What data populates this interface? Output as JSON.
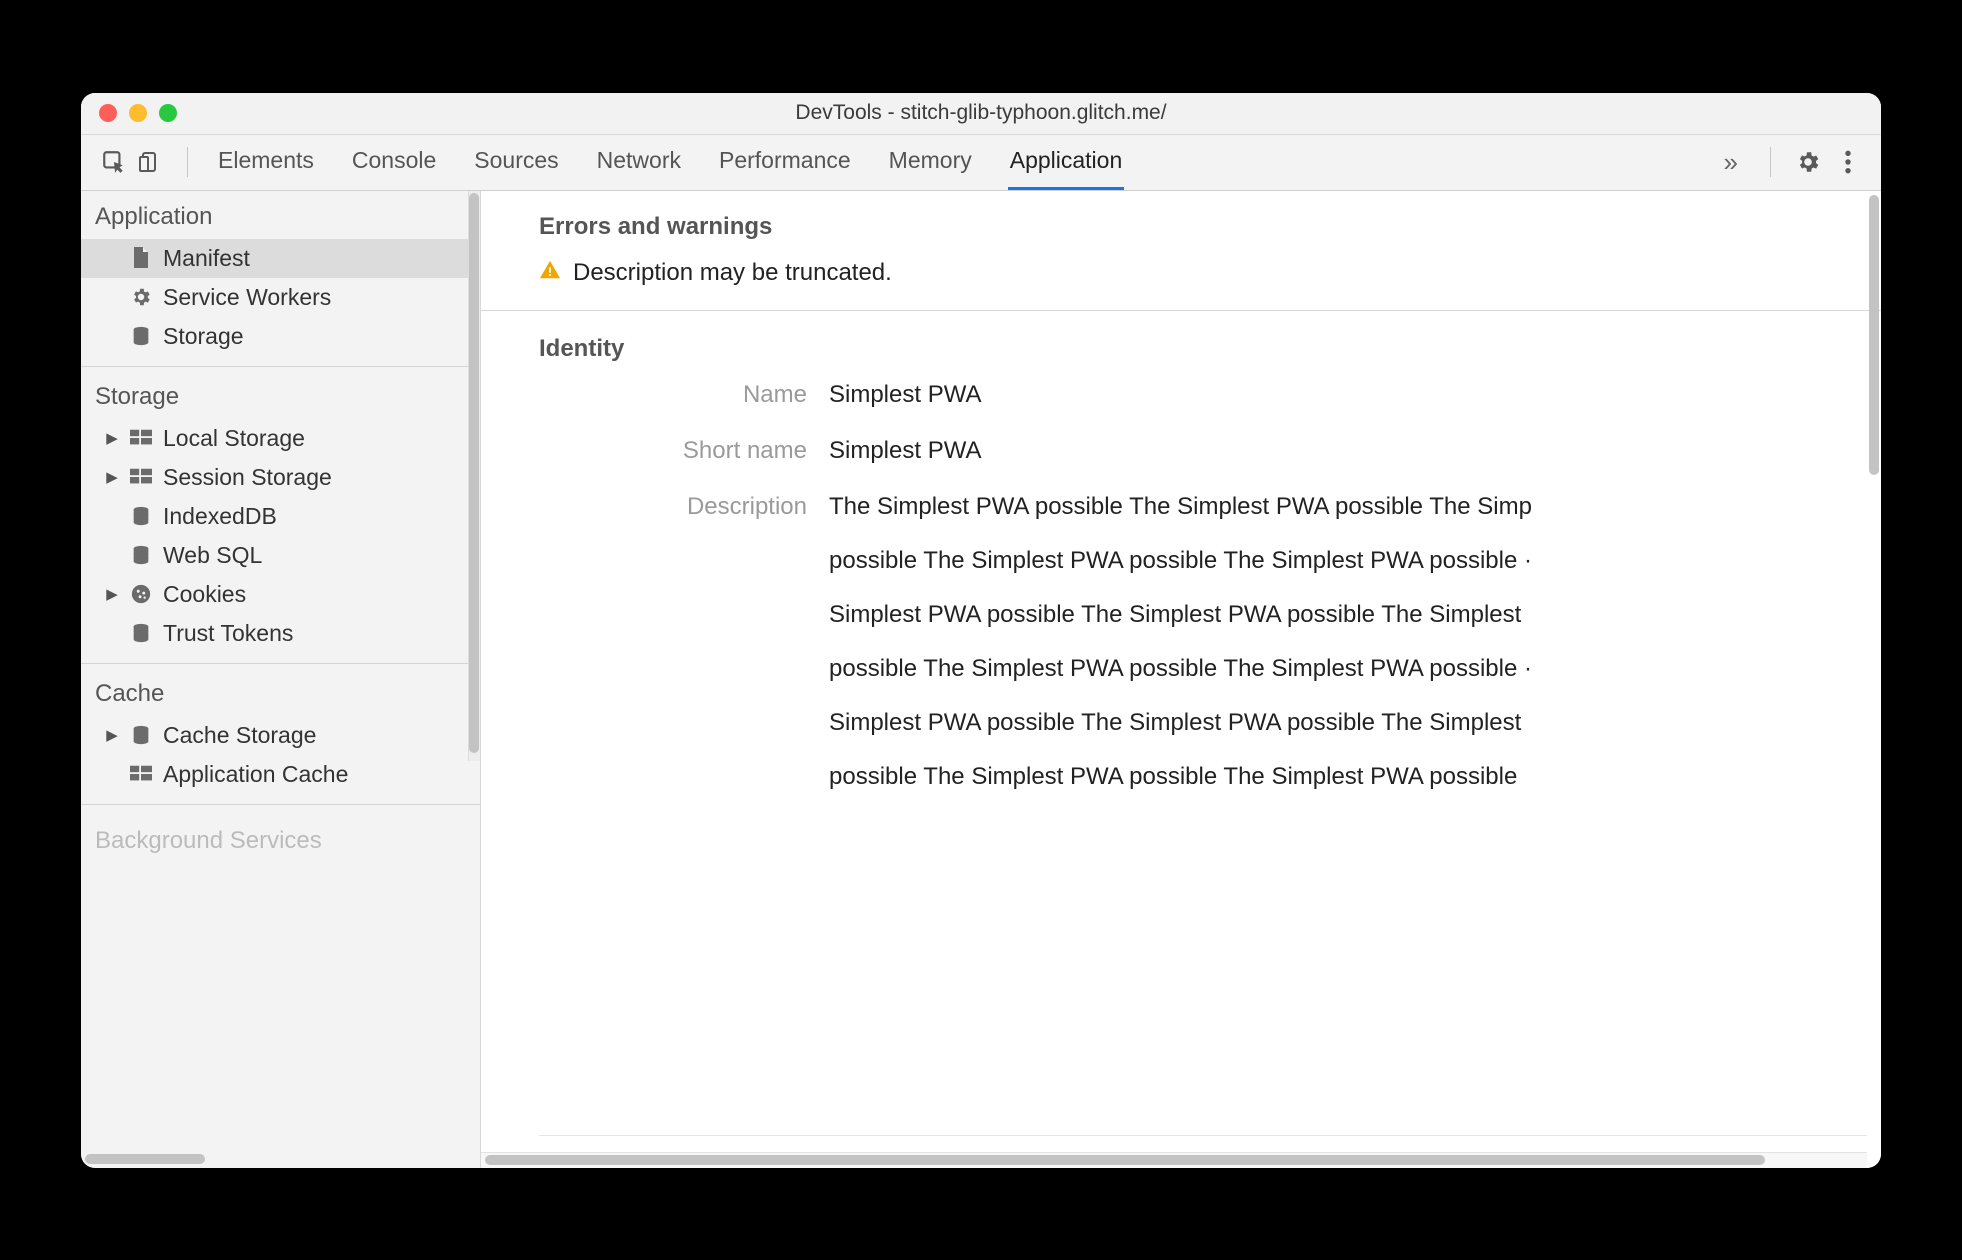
{
  "window": {
    "title": "DevTools - stitch-glib-typhoon.glitch.me/"
  },
  "toolbar": {
    "tabs": [
      "Elements",
      "Console",
      "Sources",
      "Network",
      "Performance",
      "Memory",
      "Application"
    ],
    "active": "Application",
    "overflow": "»"
  },
  "sidebar": {
    "sections": [
      {
        "title": "Application",
        "items": [
          {
            "label": "Manifest",
            "icon": "file",
            "selected": true,
            "expandable": false
          },
          {
            "label": "Service Workers",
            "icon": "gear",
            "expandable": false
          },
          {
            "label": "Storage",
            "icon": "db",
            "expandable": false
          }
        ]
      },
      {
        "title": "Storage",
        "items": [
          {
            "label": "Local Storage",
            "icon": "grid",
            "expandable": true
          },
          {
            "label": "Session Storage",
            "icon": "grid",
            "expandable": true
          },
          {
            "label": "IndexedDB",
            "icon": "db",
            "expandable": false
          },
          {
            "label": "Web SQL",
            "icon": "db",
            "expandable": false
          },
          {
            "label": "Cookies",
            "icon": "cookie",
            "expandable": true
          },
          {
            "label": "Trust Tokens",
            "icon": "db",
            "expandable": false
          }
        ]
      },
      {
        "title": "Cache",
        "items": [
          {
            "label": "Cache Storage",
            "icon": "db",
            "expandable": true
          },
          {
            "label": "Application Cache",
            "icon": "grid",
            "expandable": false
          }
        ]
      },
      {
        "title": "Background Services",
        "items": []
      }
    ]
  },
  "main": {
    "errors_title": "Errors and warnings",
    "warning": "Description may be truncated.",
    "identity_title": "Identity",
    "fields": {
      "name_label": "Name",
      "name_value": "Simplest PWA",
      "short_name_label": "Short name",
      "short_name_value": "Simplest PWA",
      "description_label": "Description",
      "description_lines": [
        "The Simplest PWA possible The Simplest PWA possible The Simp",
        "possible The Simplest PWA possible The Simplest PWA possible ·",
        "Simplest PWA possible The Simplest PWA possible The Simplest",
        "possible The Simplest PWA possible The Simplest PWA possible ·",
        "Simplest PWA possible The Simplest PWA possible The Simplest",
        "possible The Simplest PWA possible The Simplest PWA possible"
      ]
    }
  }
}
